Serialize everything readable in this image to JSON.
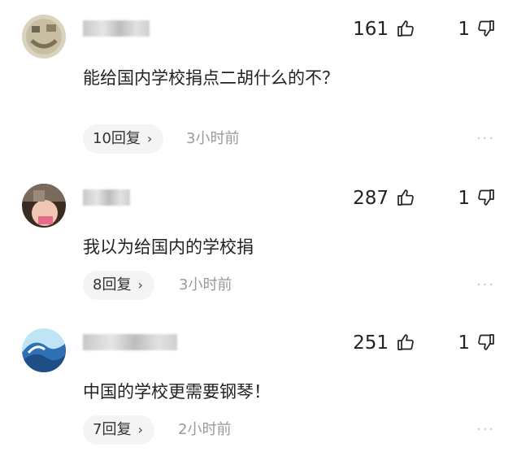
{
  "comments": [
    {
      "username": "",
      "likes": "161",
      "dislikes": "1",
      "text": "能给国内学校捐点二胡什么的不？",
      "replies": "10回复",
      "time": "3小时前",
      "avatar_colors": [
        "#cfc7b2",
        "#8c7f62"
      ]
    },
    {
      "username": "",
      "likes": "287",
      "dislikes": "1",
      "text": "我以为给国内的学校捐",
      "replies": "8回复",
      "time": "3小时前",
      "avatar_colors": [
        "#3b2c22",
        "#e56a8b"
      ]
    },
    {
      "username": "",
      "likes": "251",
      "dislikes": "1",
      "text": "中国的学校更需要钢琴！",
      "replies": "7回复",
      "time": "2小时前",
      "avatar_colors": [
        "#2f6fb3",
        "#bfe4f5"
      ]
    }
  ],
  "icons": {
    "reply_chevron": "›",
    "more": "···"
  }
}
